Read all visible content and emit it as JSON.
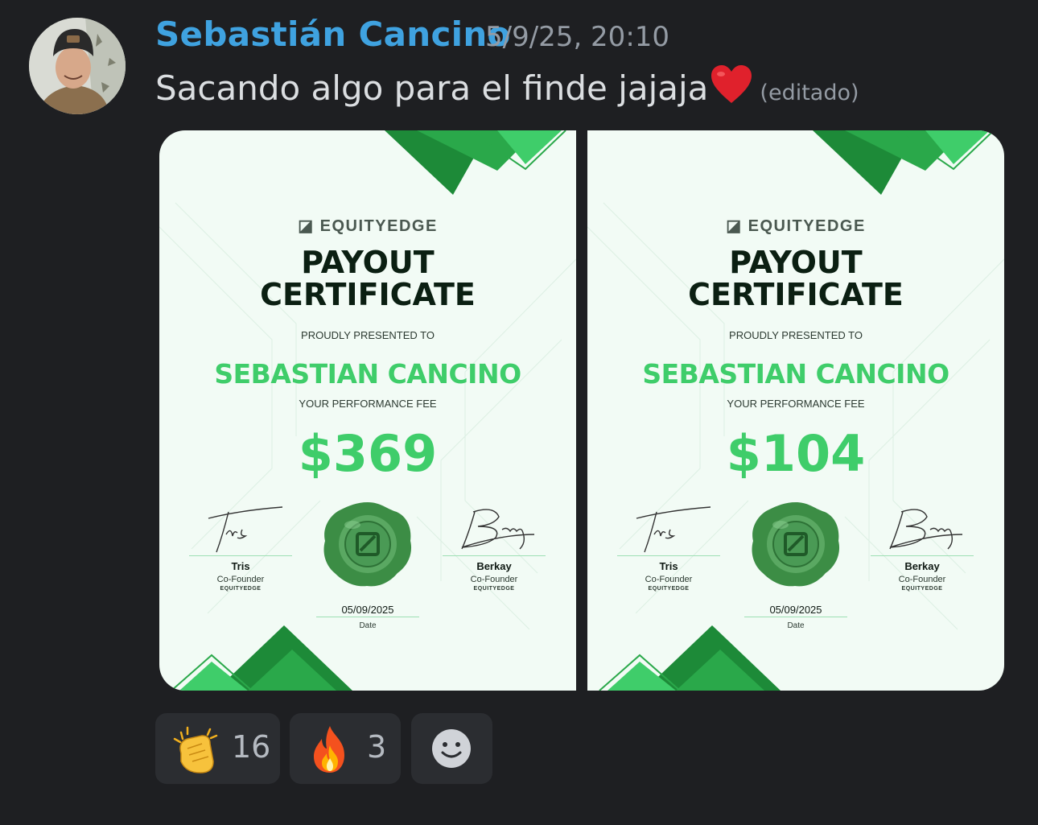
{
  "message": {
    "author": "Sebastián Cancino",
    "timestamp": "5/9/25, 20:10",
    "text": "Sacando algo para el finde jajaja",
    "emoji": "heart-emoji",
    "edited_label": "(editado)"
  },
  "attachments": [
    {
      "brand": "EQUITYEDGE",
      "title_line1": "PAYOUT",
      "title_line2": "CERTIFICATE",
      "presented_label": "PROUDLY PRESENTED TO",
      "recipient": "SEBASTIAN CANCINO",
      "fee_label": "YOUR PERFORMANCE FEE",
      "amount": "$369",
      "signer1_name": "Tris",
      "signer1_role": "Co-Founder",
      "signer1_brand": "EQUITYEDGE",
      "signer2_name": "Berkay",
      "signer2_role": "Co-Founder",
      "signer2_brand": "EQUITYEDGE",
      "date": "05/09/2025",
      "date_label": "Date"
    },
    {
      "brand": "EQUITYEDGE",
      "title_line1": "PAYOUT",
      "title_line2": "CERTIFICATE",
      "presented_label": "PROUDLY PRESENTED TO",
      "recipient": "SEBASTIAN CANCINO",
      "fee_label": "YOUR PERFORMANCE FEE",
      "amount": "$104",
      "signer1_name": "Tris",
      "signer1_role": "Co-Founder",
      "signer1_brand": "EQUITYEDGE",
      "signer2_name": "Berkay",
      "signer2_role": "Co-Founder",
      "signer2_brand": "EQUITYEDGE",
      "date": "05/09/2025",
      "date_label": "Date"
    }
  ],
  "reactions": [
    {
      "emoji": "clapping-hands-emoji",
      "count": "16"
    },
    {
      "emoji": "fire-emoji",
      "count": "3"
    }
  ],
  "add_reaction_icon": "smiley-icon",
  "colors": {
    "background": "#1e1f22",
    "author": "#3fa2e0",
    "accent_green": "#3fcd6a",
    "reaction_bg": "#2b2d31"
  }
}
